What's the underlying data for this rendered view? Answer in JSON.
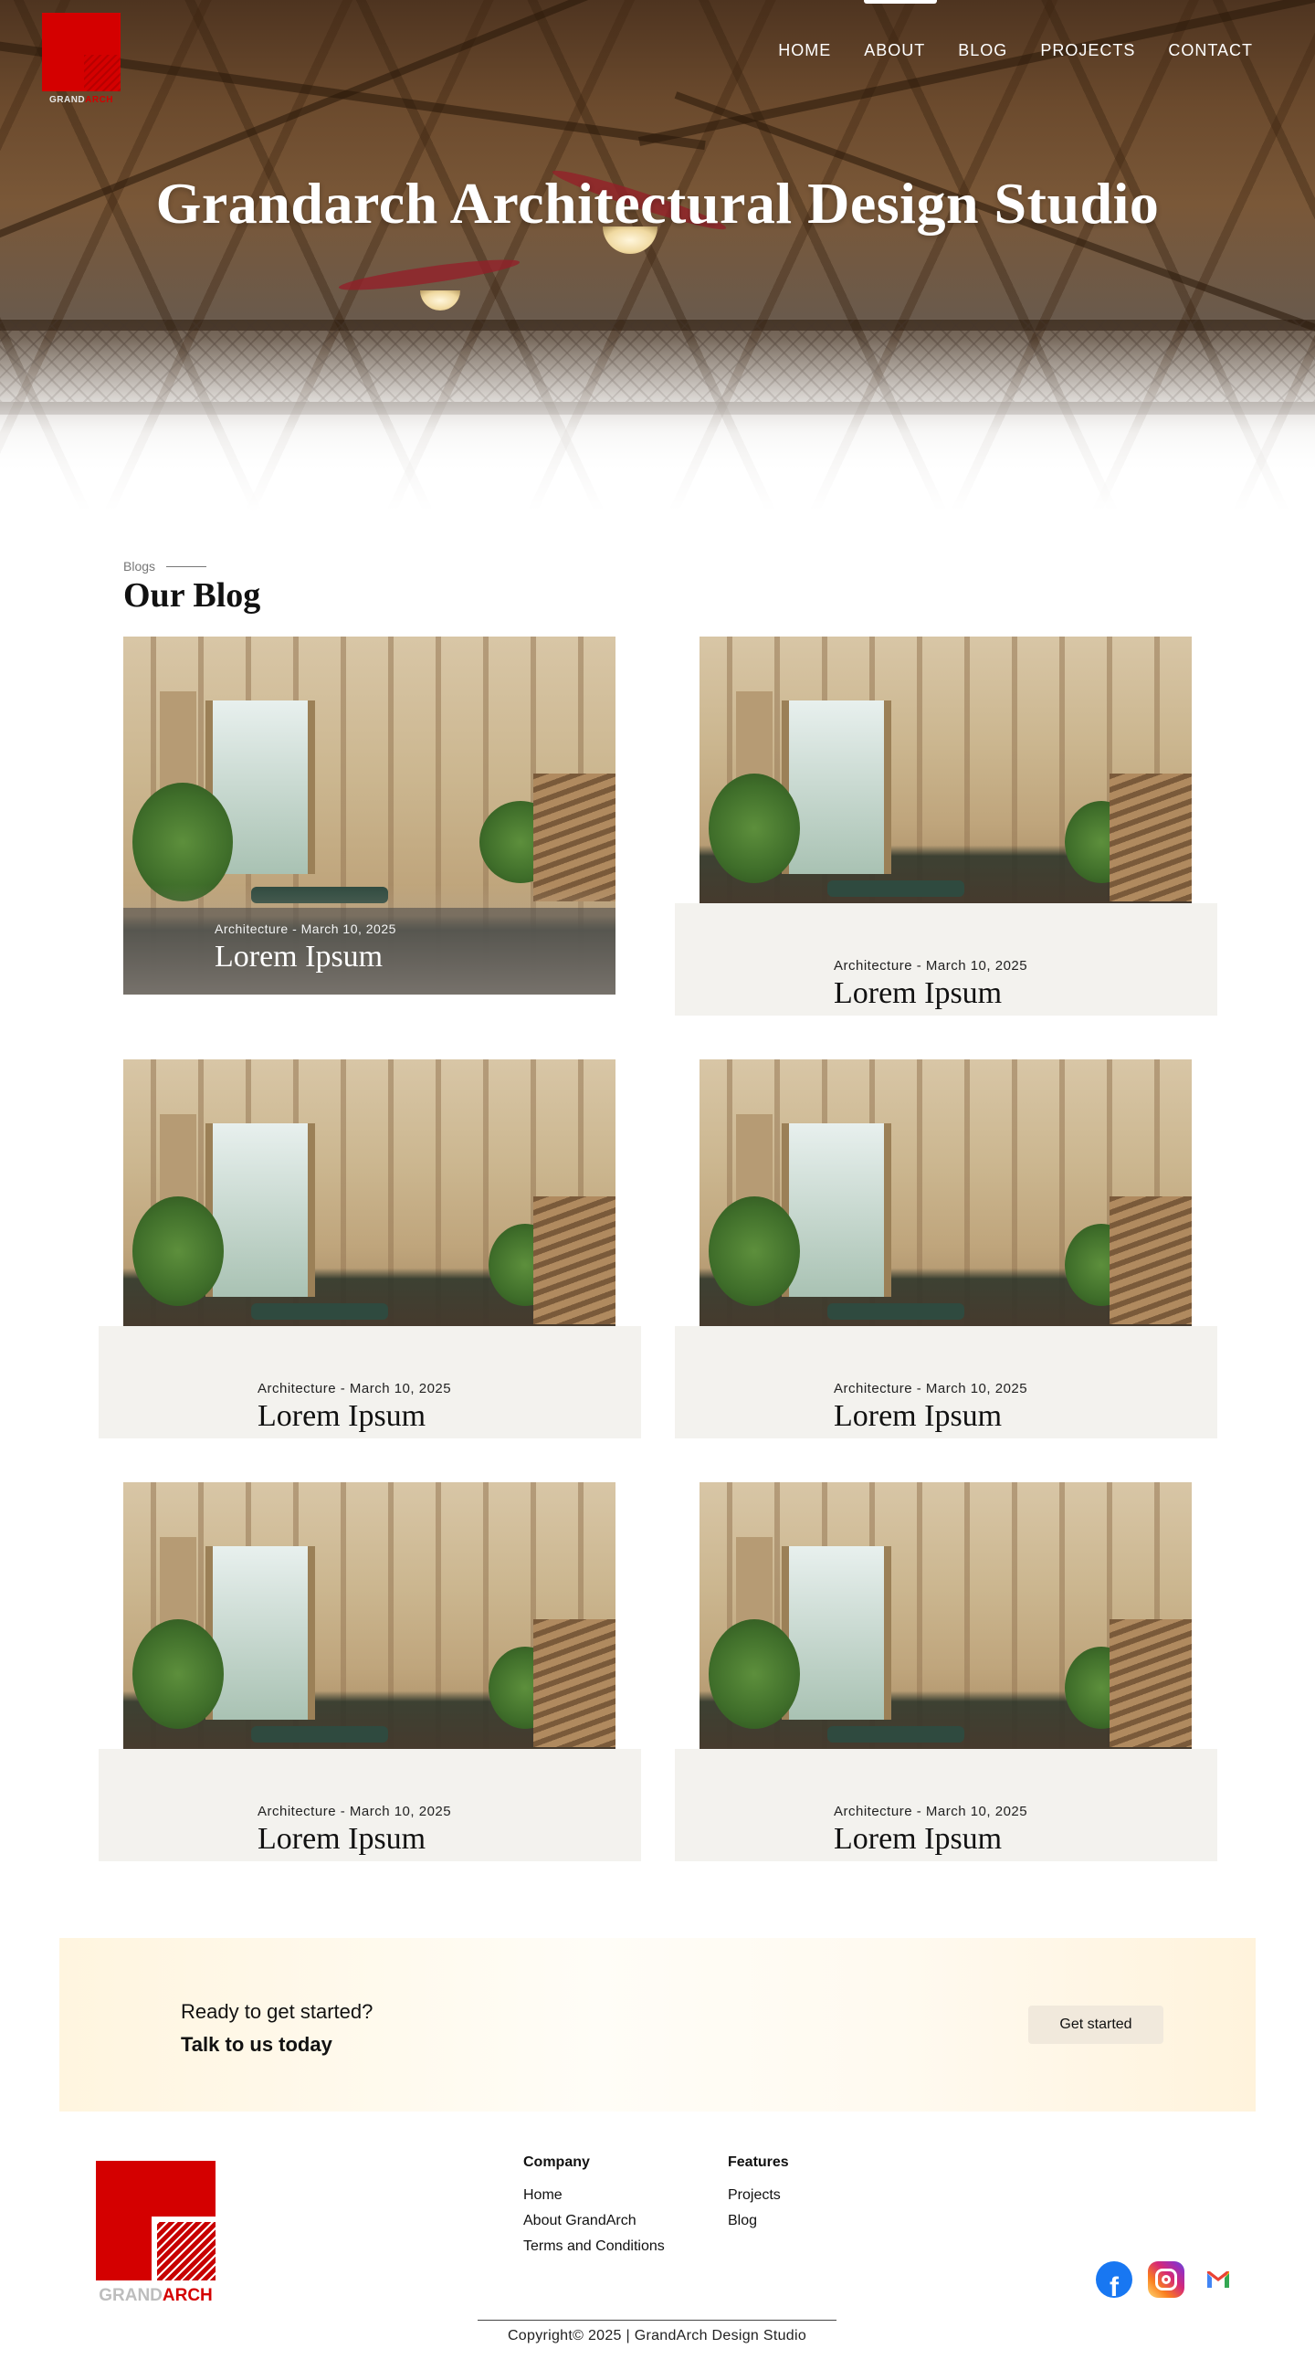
{
  "brand": {
    "word_grand": "GRAND",
    "word_arch": "ARCH"
  },
  "nav": {
    "items": [
      "HOME",
      "ABOUT",
      "BLOG",
      "PROJECTS",
      "CONTACT"
    ]
  },
  "hero": {
    "title": "Grandarch Architectural Design Studio"
  },
  "blog": {
    "kicker": "Blogs",
    "title": "Our Blog",
    "posts": [
      {
        "meta": "Architecture - March 10, 2025",
        "title": "Lorem Ipsum"
      },
      {
        "meta": "Architecture - March 10, 2025",
        "title": "Lorem Ipsum"
      },
      {
        "meta": "Architecture - March 10, 2025",
        "title": "Lorem Ipsum"
      },
      {
        "meta": "Architecture - March 10, 2025",
        "title": "Lorem Ipsum"
      },
      {
        "meta": "Architecture - March 10, 2025",
        "title": "Lorem Ipsum"
      },
      {
        "meta": "Architecture - March 10, 2025",
        "title": "Lorem Ipsum"
      }
    ]
  },
  "cta": {
    "line1": "Ready to get started?",
    "line2": "Talk to us today",
    "button": "Get started"
  },
  "footer": {
    "company": {
      "heading": "Company",
      "links": [
        "Home",
        "About GrandArch",
        "Terms and Conditions"
      ]
    },
    "features": {
      "heading": "Features",
      "links": [
        "Projects",
        "Blog"
      ]
    },
    "social": [
      "facebook-icon",
      "instagram-icon",
      "gmail-icon"
    ],
    "copyright": "Copyright© 2025 | GrandArch Design Studio"
  },
  "colors": {
    "brand_red": "#d40000",
    "panel": "#f3f2ee",
    "cta_bg": "#fff5df"
  }
}
